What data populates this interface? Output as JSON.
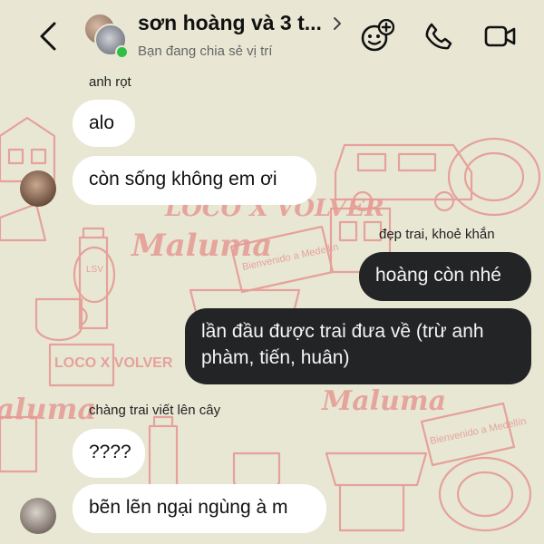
{
  "header": {
    "title": "sơn hoàng và 3 t...",
    "subtitle": "Bạn đang chia sẻ vị trí",
    "back_icon": "chevron-left-icon",
    "avatar": "group-avatar",
    "actions": [
      "add-effect-icon",
      "phone-icon",
      "video-camera-icon"
    ]
  },
  "wallpaper_text": {
    "maluma": "Maluma",
    "bienvenido": "Bienvenido a Medellín",
    "loco_volver": "LOCO X VOLVER",
    "lv": "LSV"
  },
  "messages": [
    {
      "sender": "anh rọt",
      "direction": "in",
      "text": "alo"
    },
    {
      "direction": "in",
      "text": "còn sống không em ơi"
    },
    {
      "sender": "đẹp trai, khoẻ khắn",
      "direction": "out",
      "text": "hoàng còn nhé"
    },
    {
      "direction": "out",
      "text": "lần đầu được trai đưa về (trừ anh phàm, tiến, huân)"
    },
    {
      "sender": "chàng trai viết lên cây",
      "direction": "in",
      "text": "????"
    },
    {
      "direction": "in",
      "text": "bẽn lẽn ngại ngùng à m"
    }
  ],
  "colors": {
    "background": "#e8e7d4",
    "doodle": "#e59a94",
    "incoming_bubble": "#ffffff",
    "outgoing_bubble": "#232425",
    "online": "#2fbf45"
  }
}
